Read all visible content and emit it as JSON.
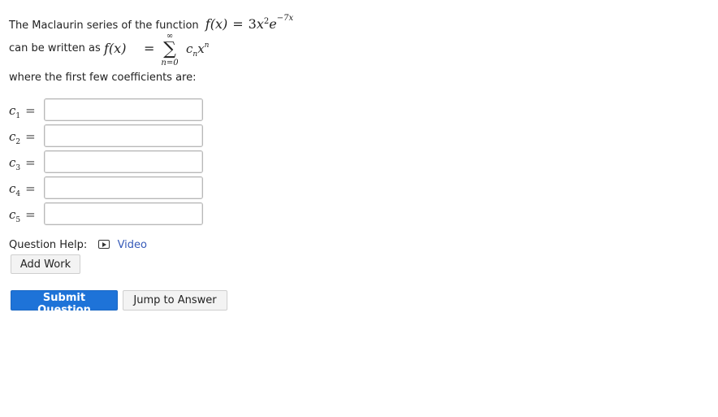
{
  "question": {
    "intro": "The Maclaurin series of the function",
    "func_lhs": "f(x)",
    "func_rhs_coef": "3x",
    "func_rhs_power": "2",
    "func_rhs_base": "e",
    "func_rhs_exp": "−7x",
    "line2_text": "can be written as",
    "sum_lhs": "f(x)",
    "sum_top": "∞",
    "sum_symbol": "∑",
    "sum_bottom": "n=0",
    "sum_term_base": "c",
    "sum_term_sub": "n",
    "sum_term_var": "x",
    "sum_term_power": "n",
    "line3_text": "where the first few coefficients are:"
  },
  "coefficients": [
    {
      "letter": "c",
      "sub": "1",
      "value": ""
    },
    {
      "letter": "c",
      "sub": "2",
      "value": ""
    },
    {
      "letter": "c",
      "sub": "3",
      "value": ""
    },
    {
      "letter": "c",
      "sub": "4",
      "value": ""
    },
    {
      "letter": "c",
      "sub": "5",
      "value": ""
    }
  ],
  "equals": "=",
  "help": {
    "label": "Question Help:",
    "video_label": "Video",
    "icon": "video-play-icon"
  },
  "buttons": {
    "add_work": "Add Work",
    "submit": "Submit Question",
    "jump": "Jump to Answer"
  },
  "colors": {
    "submit_bg": "#1e73d8",
    "link": "#3559b8"
  }
}
